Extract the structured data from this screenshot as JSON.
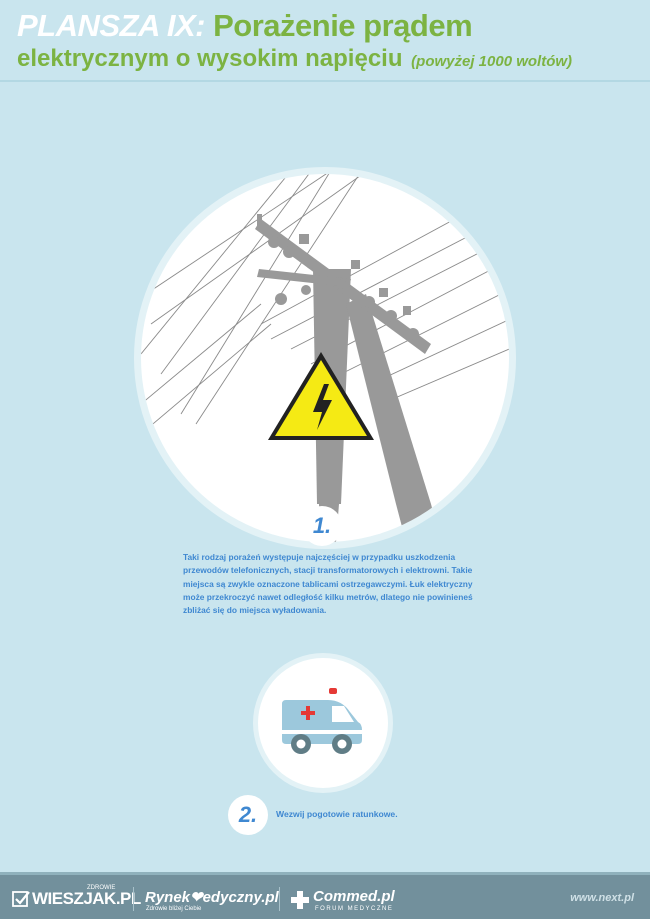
{
  "header": {
    "plansza": "PLANSZA IX:",
    "title_line1": "Porażenie prądem",
    "title_line2": "elektrycznym o wysokim napięciu",
    "title_note": "(powyżej 1000 woltów)"
  },
  "step1": {
    "number": "1.",
    "text": "Taki rodzaj porażeń występuje najczęściej w przypadku uszkodzenia przewodów telefonicznych, stacji transformatorowych i elektrowni. Takie miejsca są zwykle oznaczone tablicami ostrzegawczymi. Łuk elektryczny może przekroczyć nawet odległość kilku metrów, dlatego nie powinieneś zbliżać się do miejsca wyładowania."
  },
  "step2": {
    "number": "2.",
    "text": "Wezwij pogotowie ratunkowe."
  },
  "footer": {
    "logo1_small": "ZDROWIE",
    "logo1": "WIESZJAK.PL",
    "logo2": "Rynek❤edyczny.pl",
    "logo2_tagline": "Zdrowie bliżej Ciebie",
    "logo3": "Commed.pl",
    "logo3_tagline": "FORUM MEDYCZNE",
    "site": "www.next.pl"
  },
  "icons": {
    "warning": "high-voltage-warning-icon",
    "pole": "power-pole-illustration",
    "ambulance": "ambulance-icon"
  },
  "colors": {
    "background": "#c9e5ee",
    "title_green": "#7cb342",
    "text_blue": "#3f88d1",
    "warning_yellow": "#f5ea14",
    "footer": "#72909c"
  }
}
